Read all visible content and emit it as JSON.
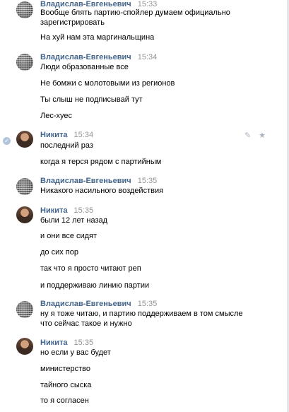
{
  "messages": [
    {
      "author": "Владислав-Евгеньевич",
      "time": "15:33",
      "avatar": "qr-code-avatar",
      "lines": [
        "Вообще блять партию-спойлер думаем официально",
        "зарегистрировать",
        "На хуй нам эта маргинальщина"
      ]
    },
    {
      "author": "Владислав-Евгеньевич",
      "time": "15:34",
      "avatar": "qr-code-avatar",
      "lines": [
        "Люди образованные все",
        "Не бомжи с молотовыми из регионов",
        "Ты слыш не подписывай тут",
        "Лес-хуес"
      ]
    },
    {
      "author": "Никита",
      "time": "15:34",
      "avatar": "photo-avatar",
      "lines": [
        "последний раз",
        "когда я терся рядом с партийным"
      ]
    },
    {
      "author": "Владислав-Евгеньевич",
      "time": "15:35",
      "avatar": "qr-code-avatar",
      "lines": [
        "Никакого насильного воздействия"
      ]
    },
    {
      "author": "Никита",
      "time": "15:35",
      "avatar": "photo-avatar",
      "lines": [
        "были 12 лет назад",
        "и они все сидят",
        "до сих пор",
        "так что я просто читают реп",
        "и поддерживаю линию партии"
      ]
    },
    {
      "author": "Владислав-Евгеньевич",
      "time": "15:35",
      "avatar": "qr-code-avatar",
      "lines": [
        "ну я тоже читаю, и партию поддерживаем в том смысле",
        "что сейчас такое и нужно"
      ]
    },
    {
      "author": "Никита",
      "time": "15:35",
      "avatar": "photo-avatar",
      "lines": [
        "но если у вас будет",
        "министерство",
        "тайного сыска",
        "то я согласен"
      ]
    }
  ],
  "icons": {
    "selected_check": "checkmark-icon",
    "edit": "pencil-icon",
    "favorite": "star-icon"
  },
  "colors": {
    "author": "#42648b",
    "time": "#939393",
    "text": "#000000",
    "check": "#b3c5dc"
  }
}
